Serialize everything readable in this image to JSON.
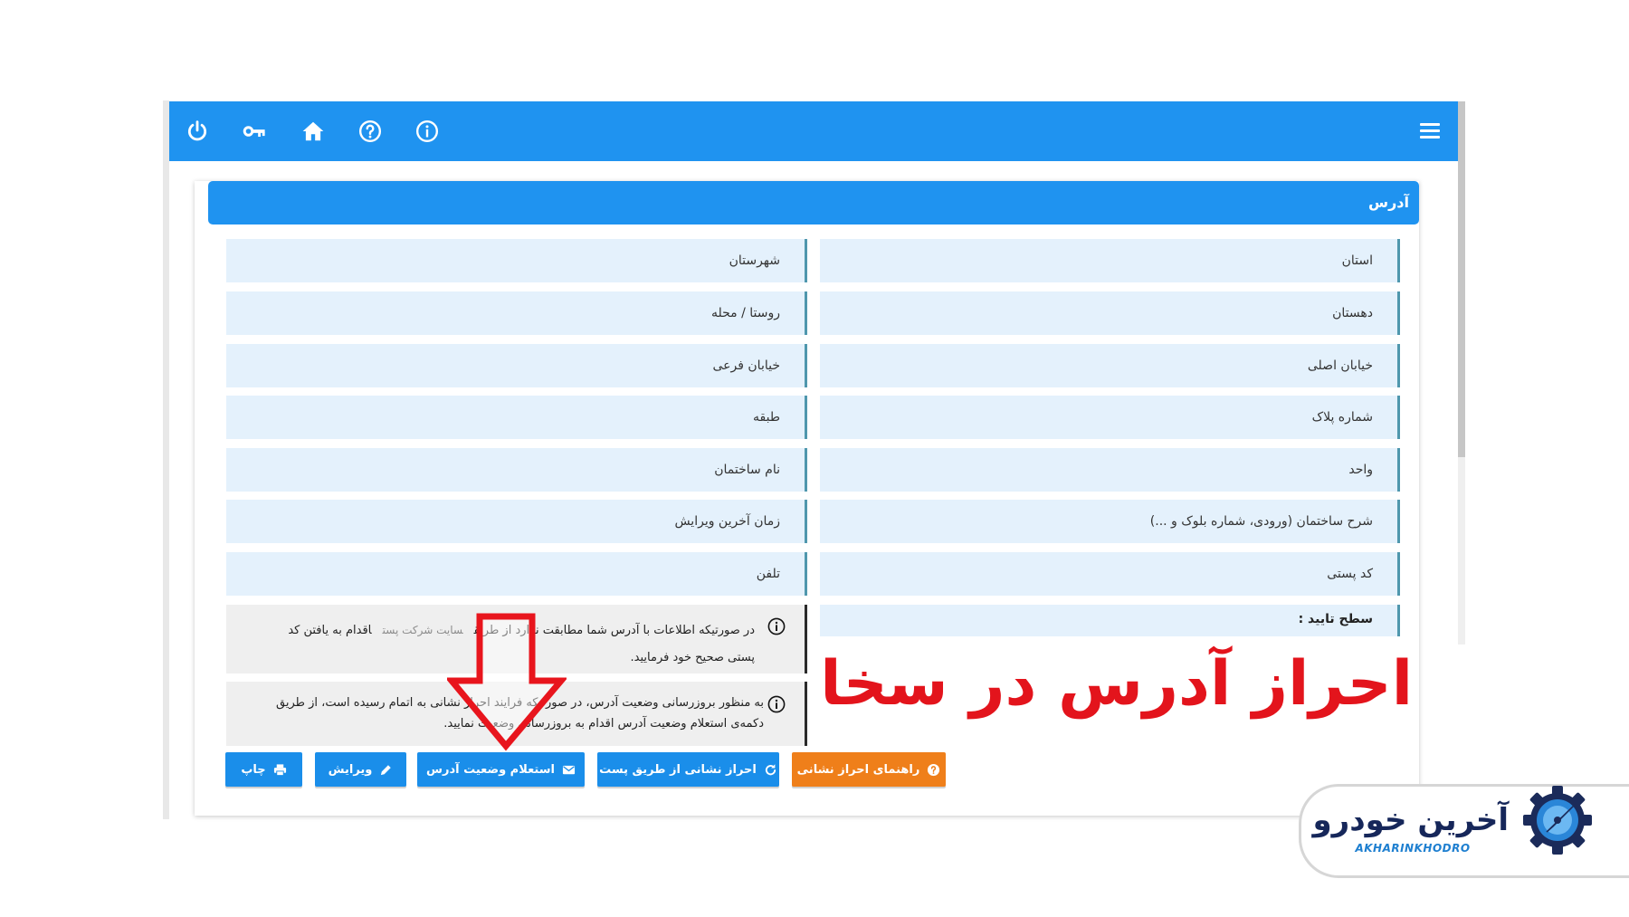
{
  "colors": {
    "primary": "#1f93f0",
    "accent": "#ef7f1a",
    "field_bg": "#e4f1fc",
    "field_border": "#4f97ad",
    "headline": "#e3141c",
    "logo_navy": "#16275a",
    "logo_blue": "#1e7fd0"
  },
  "topbar": {
    "icons": [
      "power-icon",
      "key-icon",
      "home-icon",
      "help-icon",
      "info-icon"
    ],
    "menu_icon": "hamburger-menu-icon"
  },
  "panel": {
    "title": "آدرس"
  },
  "fields": {
    "right": [
      {
        "label": "استان"
      },
      {
        "label": "دهستان"
      },
      {
        "label": "خیابان اصلی"
      },
      {
        "label": "شماره پلاک"
      },
      {
        "label": "واحد"
      },
      {
        "label": "شرح ساختمان (ورودی، شماره بلوک و ...)"
      },
      {
        "label": "کد پستی"
      },
      {
        "label": "سطح تایید :"
      }
    ],
    "left": [
      {
        "label": "شهرستان"
      },
      {
        "label": "روستا / محله"
      },
      {
        "label": "خیابان فرعی"
      },
      {
        "label": "طبقه"
      },
      {
        "label": "نام ساختمان"
      },
      {
        "label": "زمان آخرین ویرایش"
      },
      {
        "label": "تلفن"
      }
    ]
  },
  "notices": [
    {
      "icon": "info-circle-icon",
      "line1_start": "در صورتیکه اطلاعات با آدرس شما مطابقت ندارد از طریق",
      "link": "سایت شرکت پست",
      "line1_end": "اقدام به یافتن کد",
      "line2": "پستی صحیح خود فرمایید."
    },
    {
      "icon": "info-circle-icon",
      "line1": "به منظور بروزرسانی وضعیت آدرس، در صورتیکه فرایند احراز نشانی به اتمام رسیده است، از طریق",
      "line2": "دکمه‌ی استعلام وضعیت آدرس اقدام به بروزرسانی وضعیت نمایید."
    }
  ],
  "buttons": [
    {
      "label": "راهنمای احراز نشانی",
      "icon": "help-circle-icon"
    },
    {
      "label": "احراز نشانی از طریق پست",
      "icon": "refresh-icon"
    },
    {
      "label": "استعلام وضعیت آدرس",
      "icon": "envelope-icon"
    },
    {
      "label": "ویرایش",
      "icon": "pencil-icon"
    },
    {
      "label": "چاپ",
      "icon": "printer-icon"
    }
  ],
  "overlay": {
    "headline": "احراز آدرس در سخا",
    "arrow_icon": "down-arrow-icon"
  },
  "logo": {
    "name_fa": "آخرین خودرو",
    "name_en": "AKHARINKHODRO",
    "icon": "gear-speedometer-icon"
  }
}
